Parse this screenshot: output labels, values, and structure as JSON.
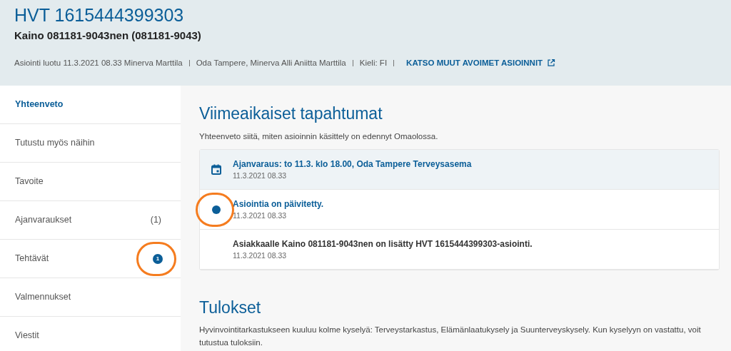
{
  "header": {
    "title": "HVT 1615444399303",
    "subtitle": "Kaino 081181-9043nen (081181-9043)",
    "meta": [
      "Asiointi luotu 11.3.2021 08.33 Minerva Marttila",
      "Oda Tampere, Minerva Alli Aniitta Marttila",
      "Kieli: FI"
    ],
    "link": "KATSO MUUT AVOIMET ASIOINNIT"
  },
  "sidebar": {
    "items": [
      {
        "label": "Yhteenveto",
        "selected": true
      },
      {
        "label": "Tutustu myös näihin",
        "selected": false
      },
      {
        "label": "Tavoite",
        "selected": false
      },
      {
        "label": "Ajanvaraukset",
        "selected": false,
        "count": "(1)"
      },
      {
        "label": "Tehtävät",
        "selected": false,
        "badge": "1"
      },
      {
        "label": "Valmennukset",
        "selected": false
      },
      {
        "label": "Viestit",
        "selected": false
      }
    ]
  },
  "recent": {
    "title": "Viimeaikaiset tapahtumat",
    "description": "Yhteenveto siitä, miten asioinnin käsittely on edennyt Omaolossa.",
    "events": [
      {
        "kind": "appointment",
        "text": "Ajanvaraus: to 11.3. klo 18.00, Oda Tampere Terveysasema",
        "time": "11.3.2021 08.33"
      },
      {
        "kind": "update",
        "text": "Asiointia on päivitetty.",
        "time": "11.3.2021 08.33"
      },
      {
        "kind": "plain",
        "text": "Asiakkaalle Kaino 081181-9043nen on lisätty HVT 1615444399303-asiointi.",
        "time": "11.3.2021 08.33"
      }
    ]
  },
  "results": {
    "title": "Tulokset",
    "description": "Hyvinvointitarkastukseen kuuluu kolme kyselyä: Terveystarkastus, Elämänlaatukysely ja Suunterveyskysely. Kun kyselyyn on vastattu, voit tutustua tuloksiin."
  }
}
